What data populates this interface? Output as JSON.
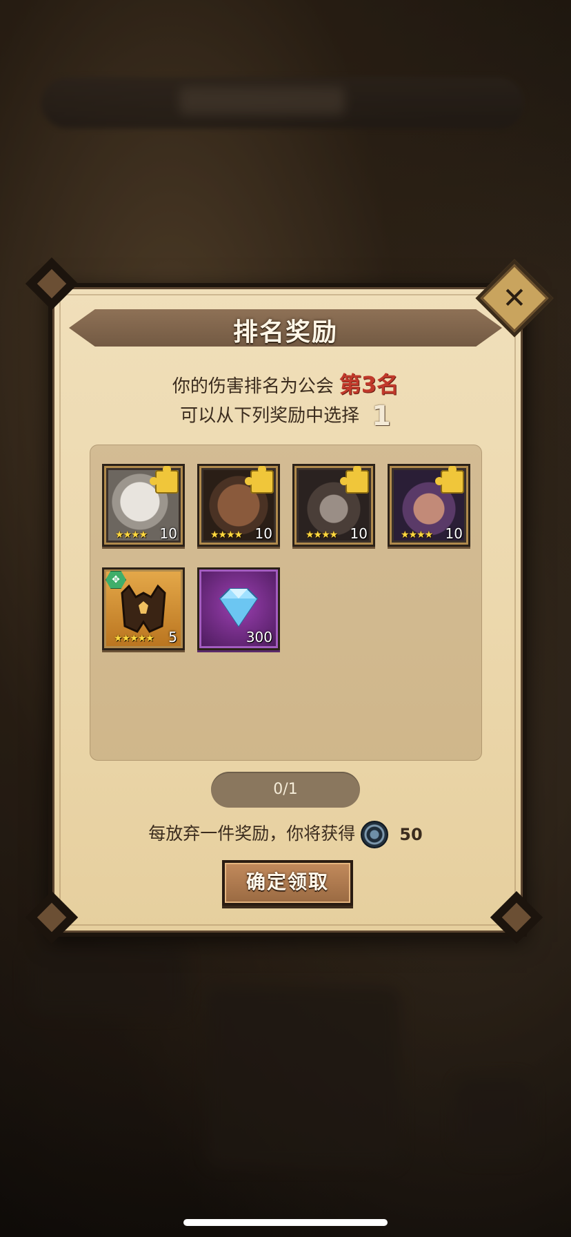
{
  "dialog": {
    "title": "排名奖励",
    "rank_text": "你的伤害排名为公会",
    "rank_value": "第3名",
    "choose_text": "可以从下列奖励中选择",
    "choose_count": "1",
    "close_icon": "close-icon"
  },
  "rewards": [
    {
      "kind": "hero-fragment",
      "icon": "puzzle-icon",
      "stars": "★★★★",
      "count": "10"
    },
    {
      "kind": "hero-fragment",
      "icon": "puzzle-icon",
      "stars": "★★★★",
      "count": "10"
    },
    {
      "kind": "hero-fragment",
      "icon": "puzzle-icon",
      "stars": "★★★★",
      "count": "10"
    },
    {
      "kind": "hero-fragment",
      "icon": "puzzle-icon",
      "stars": "★★★★",
      "count": "10"
    },
    {
      "kind": "equipment",
      "icon": "helmet-icon",
      "stars": "★★★★★",
      "count": "5"
    },
    {
      "kind": "diamond",
      "icon": "diamond-icon",
      "count": "300"
    }
  ],
  "progress": {
    "label": "0/1"
  },
  "abandon": {
    "text": "每放弃一件奖励，你将获得",
    "icon": "coin-icon",
    "value": "50"
  },
  "confirm_button": {
    "label": "确定领取"
  },
  "colors": {
    "rank": "#c0392b",
    "panel": "#ecd8ad",
    "star": "#ffd940"
  }
}
